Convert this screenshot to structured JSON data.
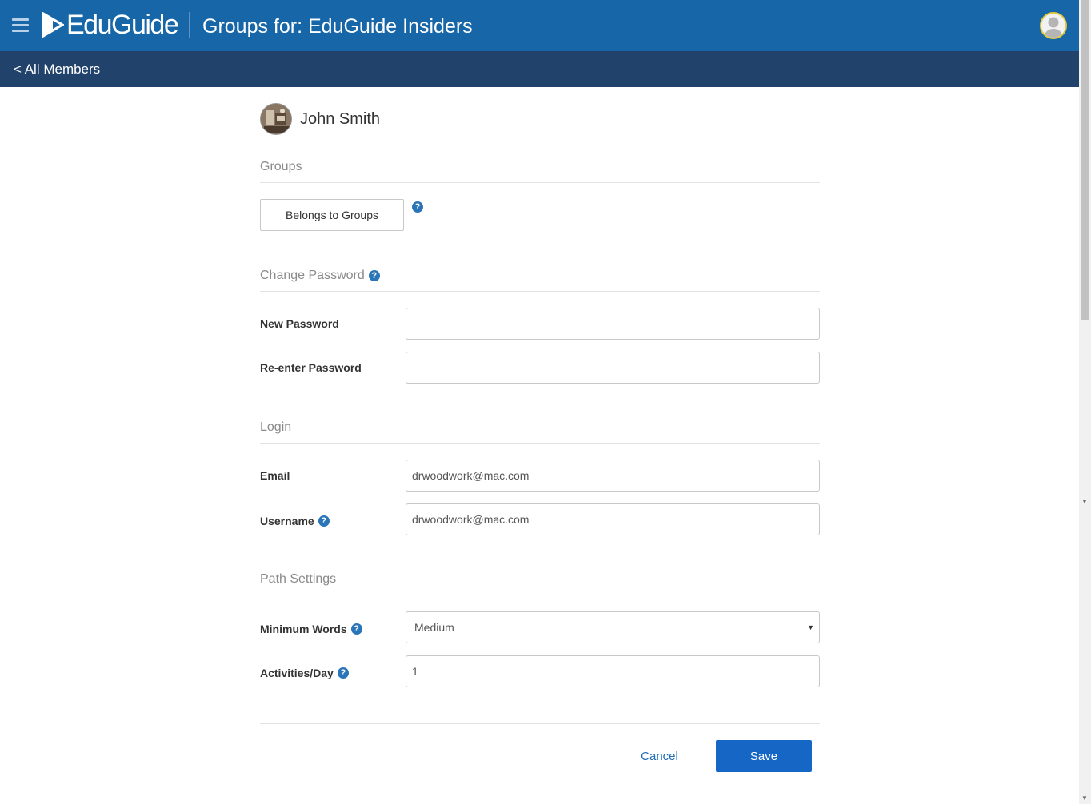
{
  "header": {
    "logo_text": "EduGuide",
    "title": "Groups for: EduGuide Insiders",
    "menu_icon": "hamburger-icon",
    "avatar_icon": "user-avatar-icon"
  },
  "subnav": {
    "back_label": "< All Members"
  },
  "member": {
    "name": "John Smith"
  },
  "sections": {
    "groups": {
      "title": "Groups",
      "button_label": "Belongs to Groups"
    },
    "password": {
      "title": "Change Password",
      "new_label": "New Password",
      "new_value": "",
      "reenter_label": "Re-enter Password",
      "reenter_value": ""
    },
    "login": {
      "title": "Login",
      "email_label": "Email",
      "email_value": "drwoodwork@mac.com",
      "username_label": "Username",
      "username_value": "drwoodwork@mac.com"
    },
    "path": {
      "title": "Path Settings",
      "min_words_label": "Minimum Words",
      "min_words_value": "Medium",
      "activities_label": "Activities/Day",
      "activities_value": "1"
    }
  },
  "actions": {
    "cancel_label": "Cancel",
    "save_label": "Save"
  },
  "colors": {
    "topbar": "#1666a8",
    "subbar": "#21436b",
    "primary_button": "#1666c5",
    "link": "#1d6cb8",
    "help_icon": "#2a74b8"
  }
}
